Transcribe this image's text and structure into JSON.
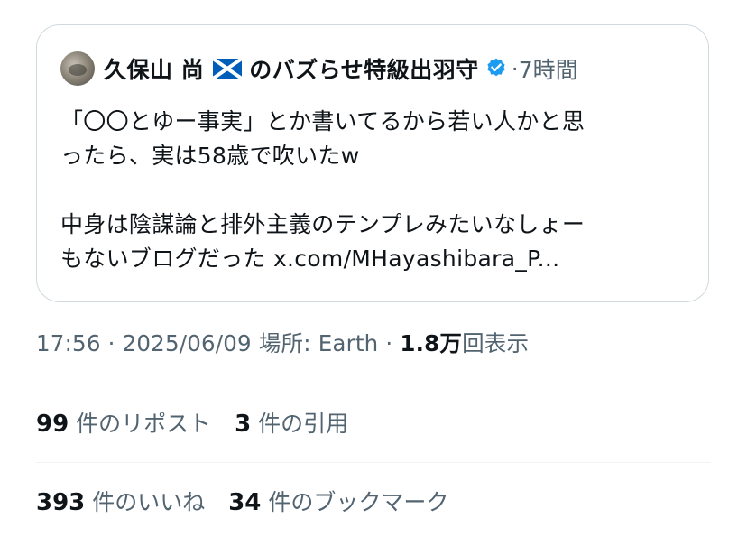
{
  "quoted_tweet": {
    "author_name": "久保山 尚",
    "author_name_suffix": "のバズらせ特級出羽守",
    "separator": "·",
    "time_ago": "7時間",
    "text_line1": "「〇〇とゆー事実」とか書いてるから若い人かと思",
    "text_line2": "ったら、実は58歳で吹いたw",
    "text_line3": "中身は陰謀論と排外主義のテンプレみたいなしょー",
    "text_line4": "もないブログだった x.com/MHayashibara_P..."
  },
  "meta": {
    "time": "17:56",
    "date": "2025/06/09",
    "location_label": "場所:",
    "location": "Earth",
    "separator": "·",
    "views_count": "1.8万",
    "views_label": "回表示"
  },
  "stats": {
    "reposts_count": "99",
    "reposts_label": "件のリポスト",
    "quotes_count": "3",
    "quotes_label": "件の引用",
    "likes_count": "393",
    "likes_label": "件のいいね",
    "bookmarks_count": "34",
    "bookmarks_label": "件のブックマーク"
  },
  "colors": {
    "text_primary": "#0f1419",
    "text_secondary": "#536471",
    "verified_blue": "#1d9bf0",
    "border": "#cfd9de",
    "flag_blue": "#005eb8"
  },
  "icons": {
    "flag": "scotland-flag-icon",
    "verified": "verified-badge-icon",
    "avatar": "avatar"
  }
}
